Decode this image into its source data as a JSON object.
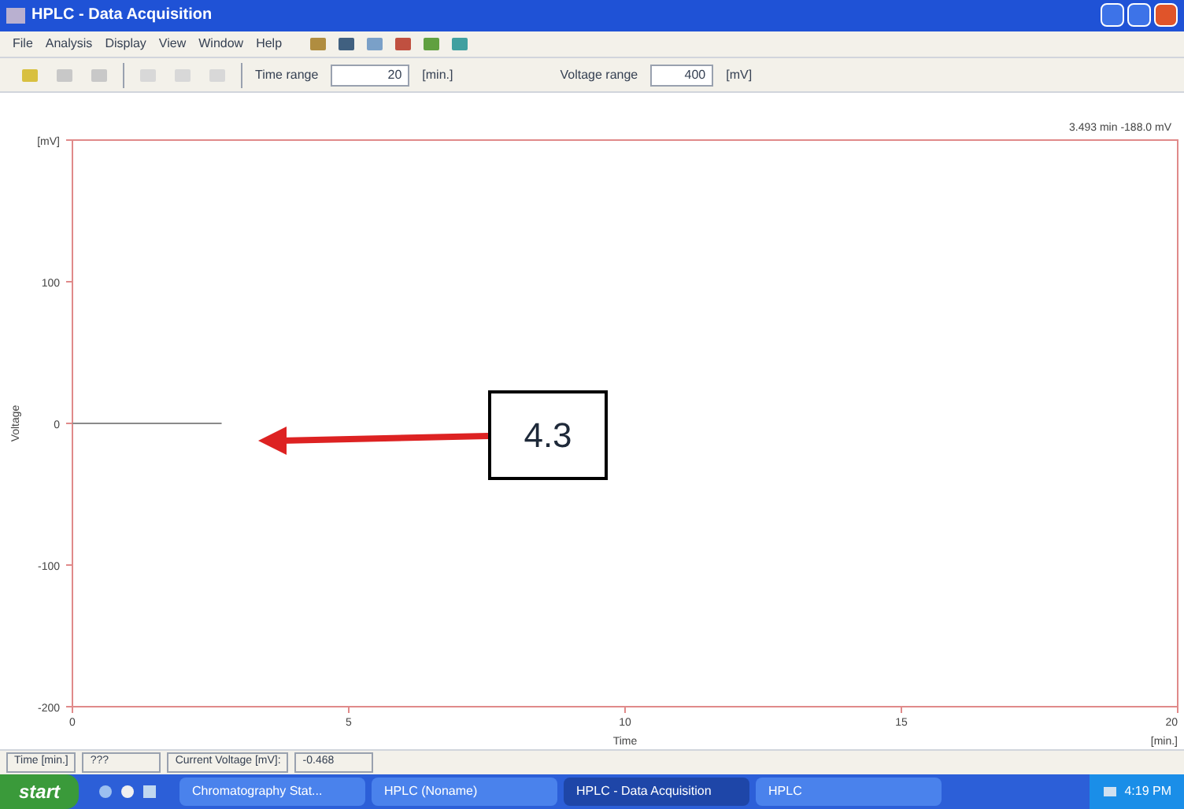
{
  "window": {
    "title": "HPLC - Data Acquisition"
  },
  "menu": [
    "File",
    "Analysis",
    "Display",
    "View",
    "Window",
    "Help"
  ],
  "toolbar": {
    "time_range": {
      "label": "Time range",
      "value": "20",
      "unit": "[min.]"
    },
    "voltage_range": {
      "label": "Voltage range",
      "value": "400",
      "unit": "[mV]"
    }
  },
  "chart": {
    "readout": "3.493 min   -188.0 mV",
    "callout": "4.3",
    "chart_data": {
      "type": "line",
      "xlabel": "Time",
      "ylabel": "Voltage",
      "x": [
        0,
        2.7
      ],
      "series": [
        {
          "color": "#8a8a8a",
          "values": [
            0,
            0
          ]
        }
      ],
      "xlim": [
        0,
        20
      ],
      "ylim": [
        -200,
        200
      ],
      "xticks": [
        0,
        5,
        10,
        15,
        {
          "value": 20,
          "label": "20\n[min.]"
        }
      ],
      "yticks": [
        -200,
        -100,
        0,
        100,
        {
          "value": 200,
          "label": "[mV]"
        }
      ]
    }
  },
  "status_bar": [
    {
      "label": "Time [min.]",
      "value": "???"
    },
    {
      "label": "Current Voltage [mV]:",
      "value": "-0.468"
    }
  ],
  "taskbar": {
    "start": "start",
    "tasks": [
      {
        "label": "Chromatography Stat...",
        "selected": false
      },
      {
        "label": "HPLC (Noname)",
        "selected": false
      },
      {
        "label": "HPLC - Data Acquisition",
        "selected": true
      },
      {
        "label": "HPLC",
        "selected": false
      }
    ],
    "clock": "4:19 PM"
  }
}
